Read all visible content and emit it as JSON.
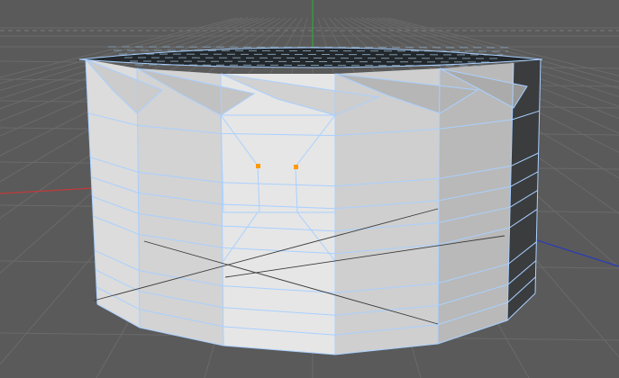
{
  "viewport": {
    "kind": "3d-perspective-viewport",
    "object": "cylinder-mesh",
    "mode": "edge-selection",
    "colors": {
      "background": "#5a5a5a",
      "grid": "#6a6a6a",
      "grid_major": "#3a3a3a",
      "x_axis": "#c23a3a",
      "y_axis": "#2fa83a",
      "z_axis": "#2a3ab8",
      "wire": "#a9d0ff",
      "selection": "#ff9a00",
      "top_cap": "#23282c",
      "top_cap_lines": "#7f98aa"
    },
    "icons": [
      "world-origin-axis-icon"
    ],
    "selected_points": 2
  }
}
